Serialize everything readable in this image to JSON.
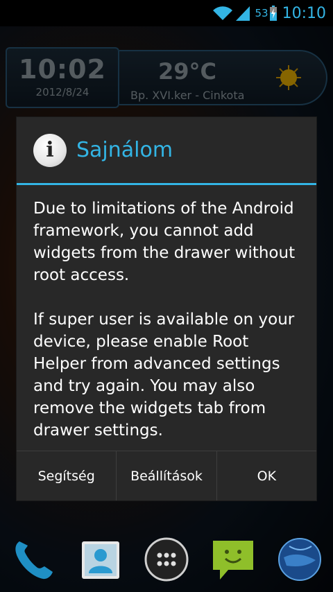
{
  "status_bar": {
    "battery_percent": "53",
    "clock": "10:10",
    "icons": [
      "wifi-icon",
      "signal-icon",
      "battery-charging-icon"
    ]
  },
  "widget": {
    "time": "10:02",
    "date": "2012/8/24",
    "temperature": "29°C",
    "location": "Bp. XVI.ker - Cinkota",
    "weather_icon": "sun-icon"
  },
  "dialog": {
    "icon": "info-icon",
    "icon_glyph": "i",
    "title": "Sajnálom",
    "paragraph1": "Due to limitations of the Android framework, you cannot add widgets from the drawer without root access.",
    "paragraph2": "If super user is available on your device, please enable Root Helper from advanced settings and try again. You may also remove the widgets tab from drawer settings.",
    "buttons": [
      "Segítség",
      "Beállítások",
      "OK"
    ]
  },
  "dock": {
    "items": [
      "phone-icon",
      "contacts-icon",
      "app-drawer-icon",
      "messaging-icon",
      "browser-icon"
    ]
  },
  "colors": {
    "accent": "#33b5e5",
    "dialog_bg": "#282828",
    "text": "#ffffff"
  }
}
